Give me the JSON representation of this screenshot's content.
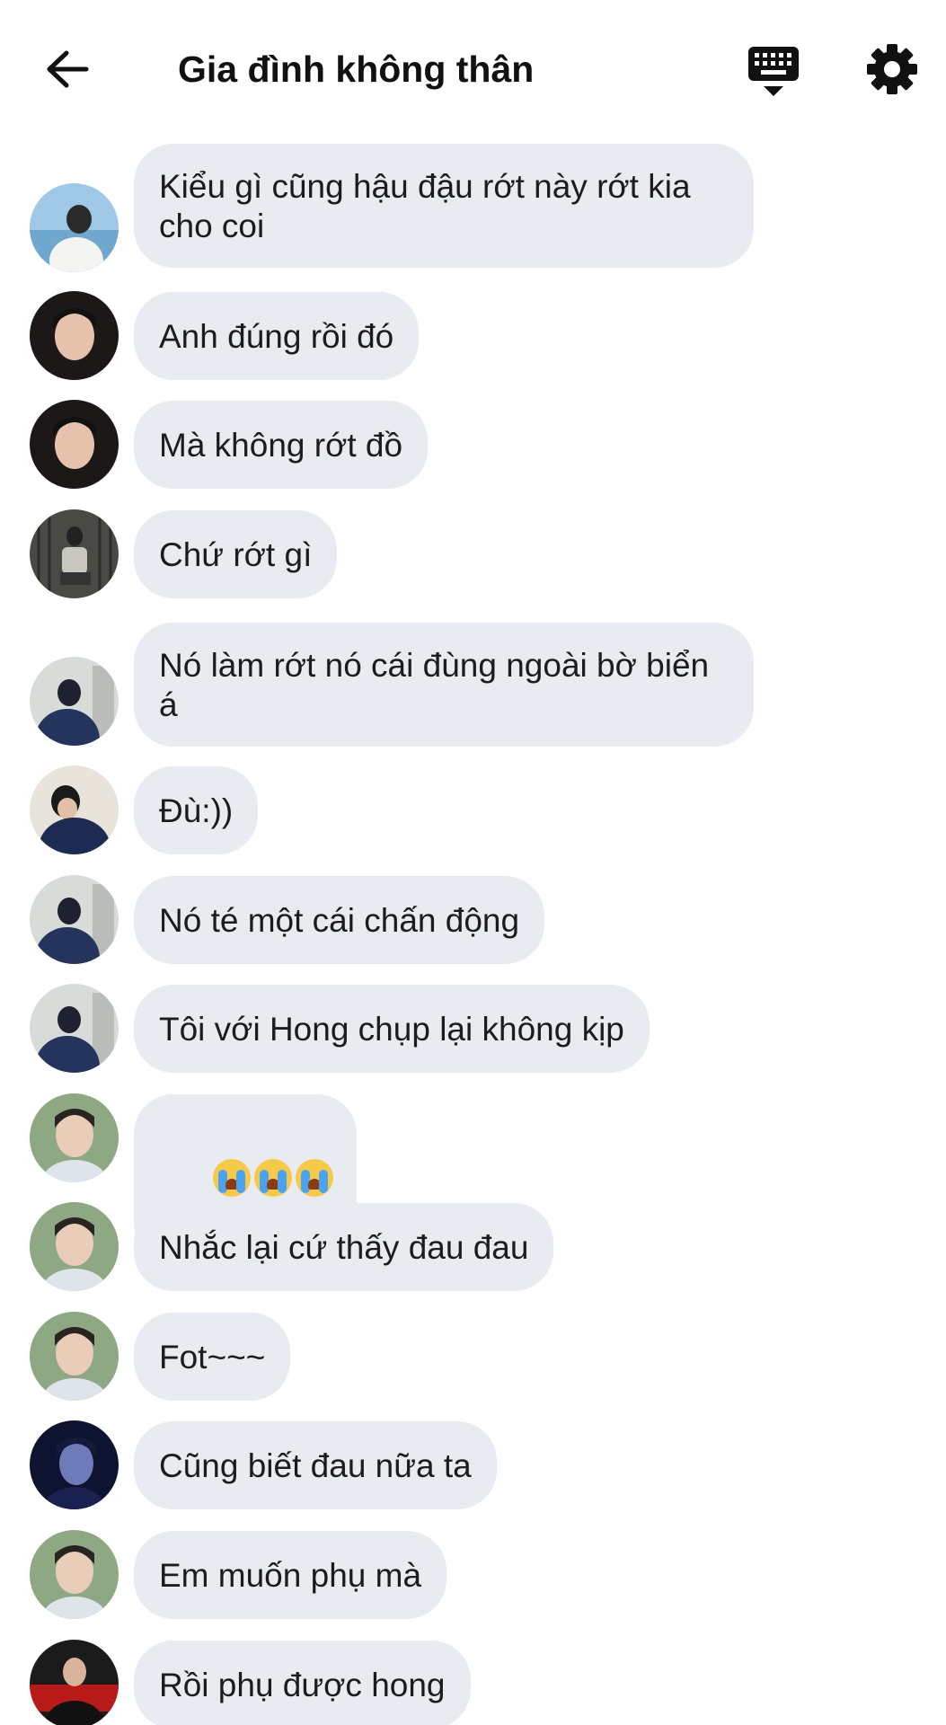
{
  "header": {
    "title": "Gia đình không thân",
    "back_icon": "arrow-left-icon",
    "keyboard_icon": "keyboard-icon",
    "settings_icon": "gear-icon"
  },
  "colors": {
    "bubble_bg": "#e8ebf0",
    "text": "#1c1c1e"
  },
  "messages": [
    {
      "text": "Kiểu gì cũng hậu đậu rớt này rớt kia\ncho coi",
      "avatar": "avatar-beach"
    },
    {
      "text": "Anh đúng rồi đó",
      "avatar": "avatar-dark-portrait"
    },
    {
      "text": "Mà không rớt đồ",
      "avatar": "avatar-dark-portrait"
    },
    {
      "text": "Chứ rớt gì",
      "avatar": "avatar-sitting"
    },
    {
      "text": "Nó làm rớt nó cái đùng ngoài bờ biển\ná",
      "avatar": "avatar-blue-shirt"
    },
    {
      "text": "Đù:))",
      "avatar": "avatar-navy-pose"
    },
    {
      "text": "Nó té một cái chấn động",
      "avatar": "avatar-blue-shirt"
    },
    {
      "text": "Tôi với Hong chụp lại không kịp",
      "avatar": "avatar-blue-shirt"
    },
    {
      "text": "",
      "emoji": "loudly-crying-face x3",
      "avatar": "avatar-green-bg"
    },
    {
      "text": "Nhắc lại cứ thấy đau đau",
      "avatar": "avatar-green-bg"
    },
    {
      "text": "Fot~~~",
      "avatar": "avatar-green-bg"
    },
    {
      "text": "Cũng biết đau nữa ta",
      "avatar": "avatar-purple-night"
    },
    {
      "text": "Em muốn phụ mà",
      "avatar": "avatar-green-bg"
    },
    {
      "text": "Rồi phụ được hong",
      "avatar": "avatar-red-poster"
    }
  ]
}
